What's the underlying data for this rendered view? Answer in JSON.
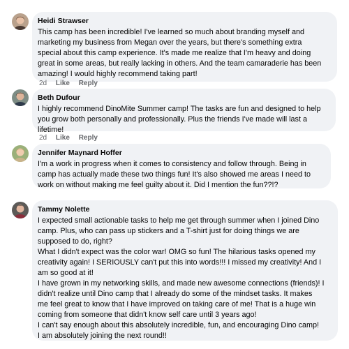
{
  "comments": [
    {
      "author": "Heidi Strawser",
      "lines": [
        "This camp has been incredible! I've learned so much about branding myself and",
        "marketing my business from Megan over the years, but there's something extra",
        "special about this camp experience. It's made me realize that I'm heavy and doing",
        "great in some areas, but really lacking in others. And the team camaraderie has been",
        "amazing! I would highly recommend taking part!"
      ],
      "time": "2d",
      "like": "Like",
      "reply": "Reply"
    },
    {
      "author": "Beth Dufour",
      "lines": [
        "I highly recommend DinoMite Summer camp! The tasks are fun and designed to help",
        "you grow both personally and professionally. Plus the friends I've made will last a",
        "lifetime!"
      ],
      "time": "2d",
      "like": "Like",
      "reply": "Reply"
    },
    {
      "author": "Jennifer Maynard Hoffer",
      "lines": [
        "I'm a work in progress when it comes to consistency and follow through. Being in",
        "camp has actually made these two things fun! It's also showed me areas I need to",
        "work on without making me feel guilty about it. Did I mention the fun??!?"
      ]
    },
    {
      "author": "Tammy Nolette",
      "lines": [
        "I expected small actionable tasks to help me get through summer when I joined Dino",
        "camp. Plus, who can pass up stickers and a T-shirt just for doing things we are",
        "supposed to do, right?",
        "What I didn't expect was the color war! OMG so fun! The hilarious tasks opened my",
        "creativity again! I SERIOUSLY can't put this into words!!! I missed my creativity! And I",
        "am so good at it!",
        "I have grown in my networking skills, and made new awesome connections (friends)! I",
        "didn't realize until Dino camp that I already do some of the mindset tasks. It makes",
        "me feel great to know that I have improved on taking care of me! That is a huge win",
        "coming from someone that didn't know self care until 3 years ago!",
        "I can't say enough about this absolutely incredible, fun, and encouraging Dino camp!",
        "I am absolutely joining the next round!!"
      ]
    }
  ],
  "colors": {
    "bubble": "#f0f2f5",
    "text": "#050505",
    "meta": "#65676b"
  }
}
